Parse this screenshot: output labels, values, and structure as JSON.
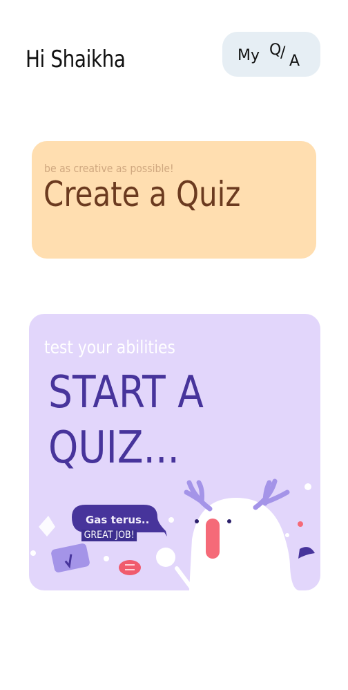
{
  "header": {
    "greeting": "Hi Shaikha",
    "my_qa": {
      "my": "My",
      "q": "Q",
      "slash": "/",
      "a": "A"
    }
  },
  "create_card": {
    "subtitle": "be as creative as possible!",
    "title": "Create a Quiz"
  },
  "start_card": {
    "subtitle": "test your abilities",
    "title": "START A QUIZ...",
    "illustration": {
      "speech_bubble": "Gas terus..",
      "badge": "GREAT JOB!"
    }
  },
  "colors": {
    "background": "#ffffff",
    "my_qa_bg": "#e6eef4",
    "create_bg": "#ffdeb0",
    "create_title": "#6b3a1f",
    "start_bg": "#e2d6fb",
    "start_title": "#47349b"
  }
}
